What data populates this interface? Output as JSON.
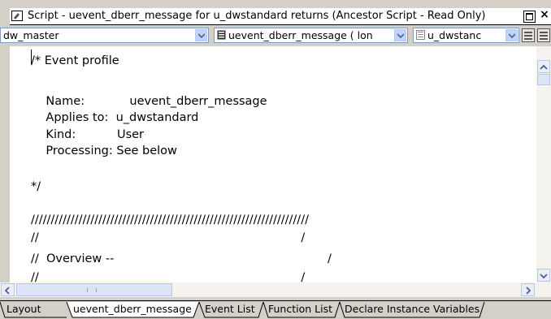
{
  "window": {
    "title": "Script - uevent_dberr_message for u_dwstandard returns  (Ancestor Script - Read Only)",
    "close_glyph": "×"
  },
  "toolbar": {
    "object_combo": "dw_master",
    "event_combo": "uevent_dberr_message ( lon",
    "ancestor_combo": "u_dwstanc"
  },
  "editor": {
    "lines": [
      "/* Event profile",
      "",
      "    Name:            uevent_dberr_message",
      "    Applies to:  u_dwstandard",
      "    Kind:           User",
      "    Processing: See below",
      "",
      "*/",
      "",
      "//////////////////////////////////////////////////////////////////////",
      "//                                                                      /",
      "//  Overview --                                                         /",
      "//                                                                      /"
    ]
  },
  "scrollbars": {
    "vertical_up": "up-arrow-icon",
    "vertical_down": "down-arrow-icon",
    "horizontal_left": "left-arrow-icon",
    "horizontal_right": "right-arrow-icon"
  },
  "tabs": [
    {
      "label": "Layout",
      "active": false
    },
    {
      "label": "uevent_dberr_message",
      "active": true
    },
    {
      "label": "Event List",
      "active": false
    },
    {
      "label": "Function List",
      "active": false
    },
    {
      "label": "Declare Instance Variables",
      "active": false
    }
  ],
  "colors": {
    "chrome": "#d4d0c8",
    "editor_bg": "#ffffff",
    "scroll_button": "#e9eef9",
    "combo_border": "#7f9db9"
  }
}
